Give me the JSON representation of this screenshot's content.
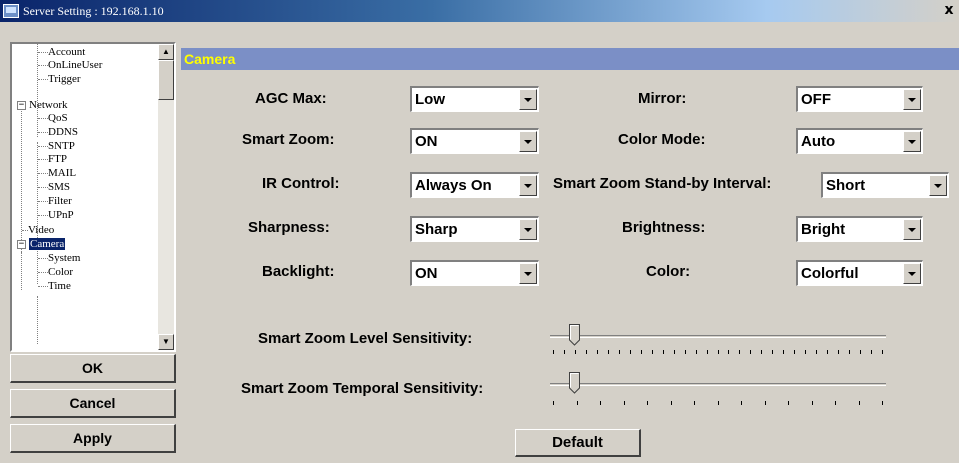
{
  "window": {
    "title": "Server Setting : 192.168.1.10",
    "close_glyph": "x"
  },
  "tree": {
    "items": [
      {
        "label": "Account"
      },
      {
        "label": "OnLineUser"
      },
      {
        "label": "Trigger"
      },
      {
        "label": "Network",
        "expander": "−"
      },
      {
        "label": "QoS"
      },
      {
        "label": "DDNS"
      },
      {
        "label": "SNTP"
      },
      {
        "label": "FTP"
      },
      {
        "label": "MAIL"
      },
      {
        "label": "SMS"
      },
      {
        "label": "Filter"
      },
      {
        "label": "UPnP"
      },
      {
        "label": "Video"
      },
      {
        "label": "Camera",
        "expander": "−",
        "selected": true
      },
      {
        "label": "System"
      },
      {
        "label": "Color"
      },
      {
        "label": "Time"
      }
    ]
  },
  "buttons": {
    "ok": "OK",
    "cancel": "Cancel",
    "apply": "Apply",
    "default": "Default"
  },
  "panel": {
    "title": "Camera",
    "fields": {
      "agc_max": {
        "label": "AGC Max:",
        "value": "Low"
      },
      "smart_zoom": {
        "label": "Smart Zoom:",
        "value": "ON"
      },
      "ir_control": {
        "label": "IR Control:",
        "value": "Always On"
      },
      "sharpness": {
        "label": "Sharpness:",
        "value": "Sharp"
      },
      "backlight": {
        "label": "Backlight:",
        "value": "ON"
      },
      "mirror": {
        "label": "Mirror:",
        "value": "OFF"
      },
      "color_mode": {
        "label": "Color Mode:",
        "value": "Auto"
      },
      "standby_interval": {
        "label": "Smart Zoom Stand-by Interval:",
        "value": "Short"
      },
      "brightness": {
        "label": "Brightness:",
        "value": "Bright"
      },
      "color": {
        "label": "Color:",
        "value": "Colorful"
      }
    },
    "sliders": {
      "level": {
        "label": "Smart Zoom Level Sensitivity:",
        "position": 0.07
      },
      "temporal": {
        "label": "Smart Zoom Temporal Sensitivity:",
        "position": 0.07
      }
    }
  }
}
